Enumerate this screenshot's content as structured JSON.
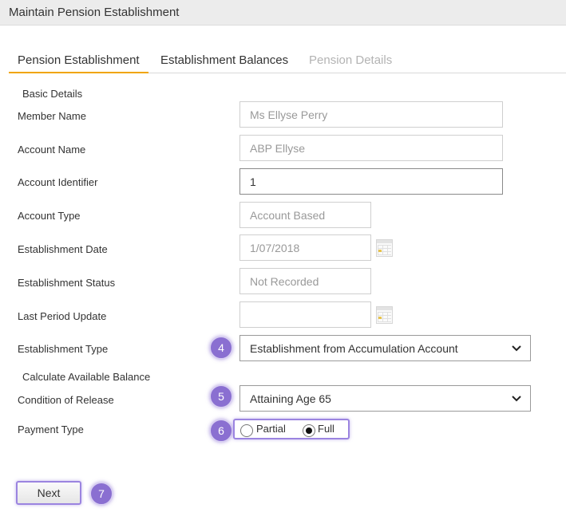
{
  "window": {
    "title": "Maintain Pension Establishment"
  },
  "tabs": [
    {
      "label": "Pension Establishment",
      "state": "active"
    },
    {
      "label": "Establishment Balances",
      "state": "normal"
    },
    {
      "label": "Pension Details",
      "state": "disabled"
    }
  ],
  "sections": {
    "basic_details": "Basic Details",
    "calculate_available_balance": "Calculate Available Balance"
  },
  "form": {
    "member_name": {
      "label": "Member Name",
      "value": "Ms Ellyse Perry"
    },
    "account_name": {
      "label": "Account Name",
      "value": "ABP Ellyse"
    },
    "account_identifier": {
      "label": "Account Identifier",
      "value": "1"
    },
    "account_type": {
      "label": "Account Type",
      "value": "Account Based"
    },
    "establishment_date": {
      "label": "Establishment Date",
      "value": "1/07/2018"
    },
    "establishment_status": {
      "label": "Establishment Status",
      "value": "Not Recorded"
    },
    "last_period_update": {
      "label": "Last Period Update",
      "value": ""
    },
    "establishment_type": {
      "label": "Establishment Type",
      "value": "Establishment from Accumulation Account"
    },
    "condition_of_release": {
      "label": "Condition of Release",
      "value": "Attaining Age 65"
    },
    "payment_type": {
      "label": "Payment Type",
      "options": [
        "Partial",
        "Full"
      ],
      "selected": "Full"
    }
  },
  "actions": {
    "next_label": "Next"
  },
  "markers": {
    "m4": "4",
    "m5": "5",
    "m6": "6",
    "m7": "7"
  },
  "colors": {
    "accent_tab": "#f0a500",
    "marker": "#8a6fd1",
    "highlight": "#9b84e0"
  },
  "icons": {
    "date_picker": "calendar-icon",
    "dropdown": "chevron-down-icon"
  }
}
